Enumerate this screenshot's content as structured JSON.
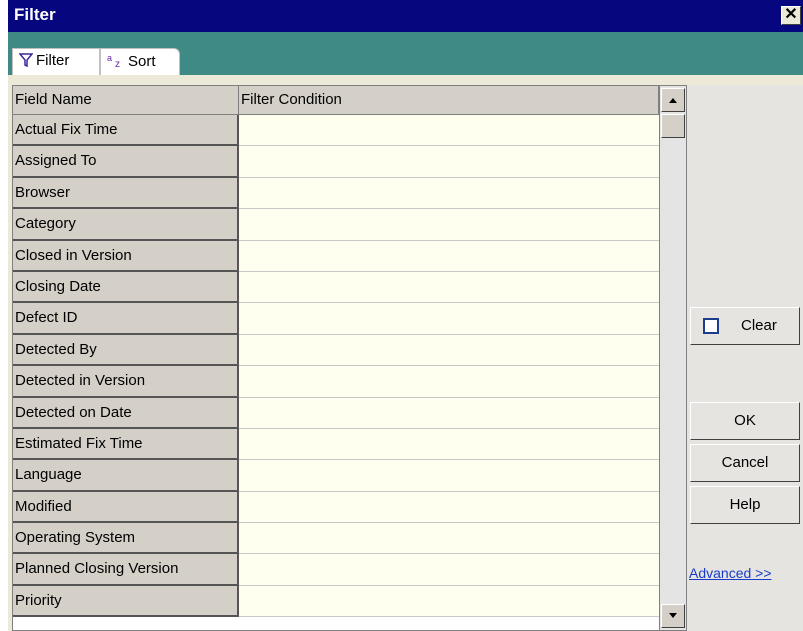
{
  "window": {
    "title": "Filter",
    "close_glyph": "✕"
  },
  "tabs": [
    {
      "label": "Filter",
      "icon": "funnel-icon"
    },
    {
      "label": "Sort",
      "icon": "sort-az-icon"
    }
  ],
  "grid": {
    "headers": {
      "field": "Field Name",
      "condition": "Filter Condition"
    },
    "rows": [
      {
        "field": "Actual Fix Time",
        "condition": ""
      },
      {
        "field": "Assigned To",
        "condition": ""
      },
      {
        "field": "Browser",
        "condition": ""
      },
      {
        "field": "Category",
        "condition": ""
      },
      {
        "field": "Closed in Version",
        "condition": ""
      },
      {
        "field": "Closing Date",
        "condition": ""
      },
      {
        "field": "Defect ID",
        "condition": ""
      },
      {
        "field": "Detected By",
        "condition": ""
      },
      {
        "field": "Detected in Version",
        "condition": ""
      },
      {
        "field": "Detected on Date",
        "condition": ""
      },
      {
        "field": "Estimated Fix Time",
        "condition": ""
      },
      {
        "field": "Language",
        "condition": ""
      },
      {
        "field": "Modified",
        "condition": ""
      },
      {
        "field": "Operating System",
        "condition": ""
      },
      {
        "field": "Planned Closing Version",
        "condition": ""
      },
      {
        "field": "Priority",
        "condition": ""
      }
    ]
  },
  "buttons": {
    "clear": "Clear",
    "ok": "OK",
    "cancel": "Cancel",
    "help": "Help"
  },
  "advanced_link": "Advanced >>"
}
